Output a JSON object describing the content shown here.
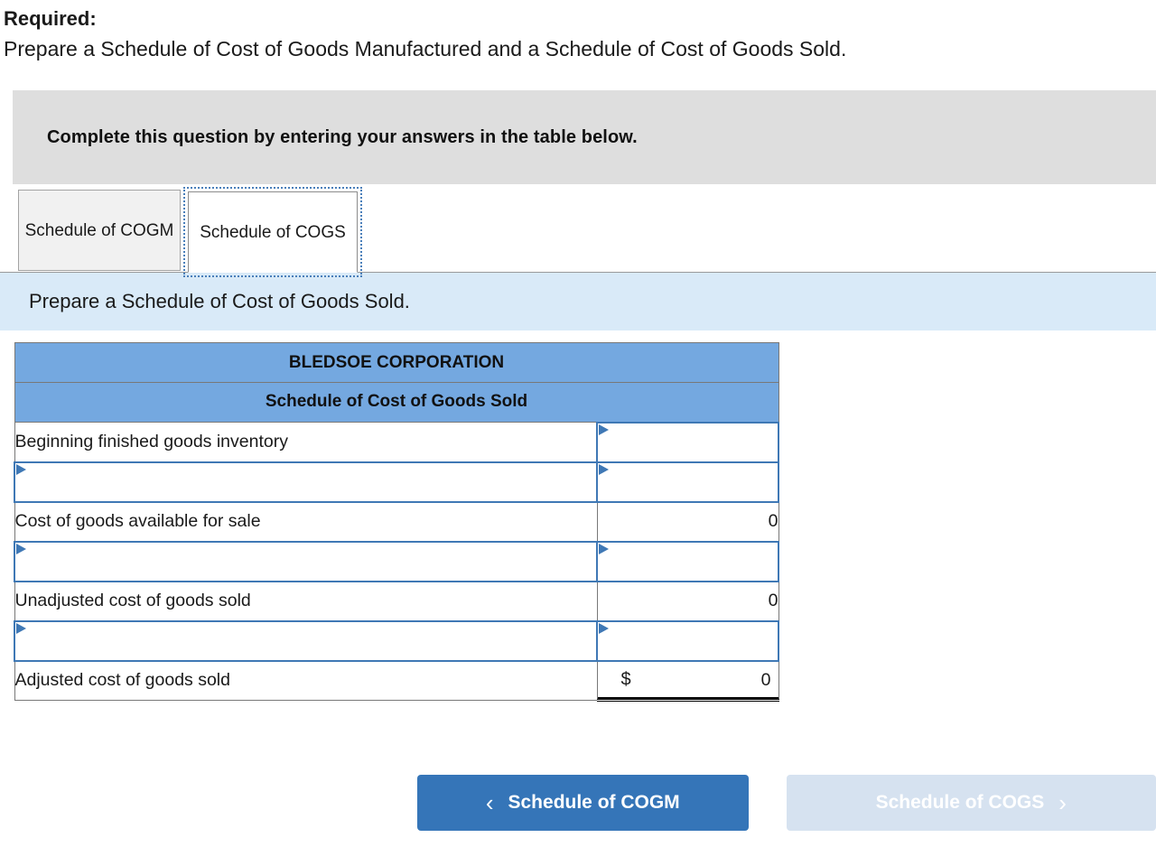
{
  "required": {
    "label": "Required:",
    "text": "Prepare a Schedule of Cost of Goods Manufactured and a Schedule of Cost of Goods Sold."
  },
  "banner": {
    "text": "Complete this question by entering your answers in the table below."
  },
  "tabs": [
    {
      "label": "Schedule of COGM",
      "active": false
    },
    {
      "label": "Schedule of COGS",
      "active": true
    }
  ],
  "instruction": {
    "text": "Prepare a Schedule of Cost of Goods Sold."
  },
  "sheet": {
    "company": "BLEDSOE CORPORATION",
    "title": "Schedule of Cost of Goods Sold",
    "rows": [
      {
        "label": "Beginning finished goods inventory",
        "value": "",
        "label_input": false,
        "value_input": true,
        "rule": "none"
      },
      {
        "label": "",
        "value": "",
        "label_input": true,
        "value_input": true,
        "rule": "none"
      },
      {
        "label": "Cost of goods available for sale",
        "value": "0",
        "label_input": false,
        "value_input": false,
        "rule": "top"
      },
      {
        "label": "",
        "value": "",
        "label_input": true,
        "value_input": true,
        "rule": "none"
      },
      {
        "label": "Unadjusted cost of goods sold",
        "value": "0",
        "label_input": false,
        "value_input": false,
        "rule": "top"
      },
      {
        "label": "",
        "value": "",
        "label_input": true,
        "value_input": true,
        "rule": "none"
      },
      {
        "label": "Adjusted cost of goods sold",
        "value": "0",
        "currency": "$",
        "label_input": false,
        "value_input": false,
        "rule": "double"
      }
    ]
  },
  "footer": {
    "prev_label": "Schedule of COGM",
    "prev_icon": "chevron-left-icon",
    "prev_chevron": "‹",
    "next_label": "Schedule of COGS",
    "next_icon": "chevron-right-icon",
    "next_chevron": "›",
    "next_disabled": true
  },
  "colors": {
    "header_blue": "#74a8e0",
    "instruction_blue": "#d9eaf8",
    "banner_gray": "#dedede",
    "button_blue": "#3575b8",
    "button_disabled": "#d6e2f0",
    "input_border": "#3f78b5"
  }
}
